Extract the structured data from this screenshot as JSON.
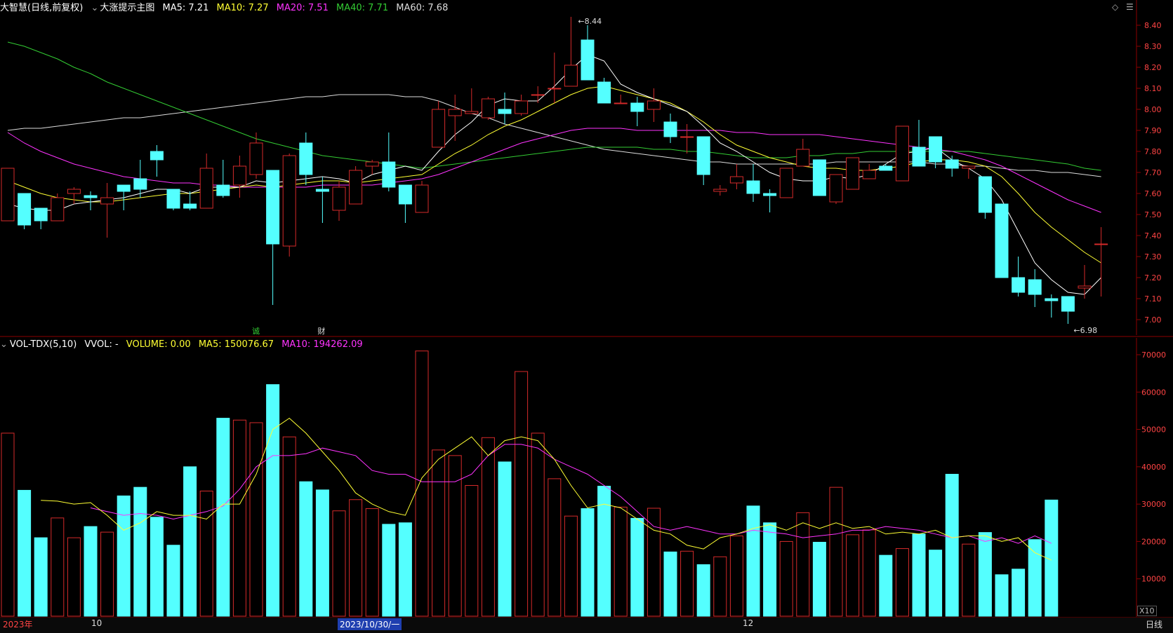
{
  "main_header": {
    "stock_name": "大智慧",
    "mode": "(日线,前复权)",
    "indicator": "大涨提示主图",
    "ma5": "MA5: 7.21",
    "ma10": "MA10: 7.27",
    "ma20": "MA20: 7.51",
    "ma40": "MA40: 7.71",
    "ma60": "MA60: 7.68"
  },
  "vol_header": {
    "indicator": "VOL-TDX(5,10)",
    "vvol": "VVOL: -",
    "volume": "VOLUME: 0.00",
    "ma5": "MA5: 150076.67",
    "ma10": "MA10: 194262.09"
  },
  "colors": {
    "up": "#d42a2a",
    "down": "#54ffff",
    "ma5": "#ffffff",
    "ma10": "#ffff33",
    "ma20": "#ff33ff",
    "ma40": "#33cc33",
    "ma60": "#dddddd",
    "axis": "#8b0000",
    "label_up": "#ff4444"
  },
  "chart_data": {
    "type": "candlestick",
    "price_axis": {
      "ticks": [
        "8.40",
        "8.30",
        "8.20",
        "8.10",
        "8.00",
        "7.90",
        "7.80",
        "7.70",
        "7.60",
        "7.50",
        "7.40",
        "7.30",
        "7.20",
        "7.10",
        "7.00"
      ],
      "range": [
        6.94,
        8.48
      ]
    },
    "annotations": {
      "high": "8.44",
      "low": "6.98"
    },
    "event_markers": [
      "诚",
      "财"
    ],
    "candles": [
      [
        7.47,
        7.72,
        7.47,
        7.72
      ],
      [
        7.6,
        7.6,
        7.43,
        7.45
      ],
      [
        7.53,
        7.53,
        7.43,
        7.47
      ],
      [
        7.47,
        7.6,
        7.47,
        7.58
      ],
      [
        7.6,
        7.63,
        7.55,
        7.62
      ],
      [
        7.59,
        7.61,
        7.52,
        7.58
      ],
      [
        7.55,
        7.65,
        7.39,
        7.58
      ],
      [
        7.64,
        7.64,
        7.52,
        7.61
      ],
      [
        7.67,
        7.76,
        7.58,
        7.62
      ],
      [
        7.8,
        7.83,
        7.68,
        7.76
      ],
      [
        7.62,
        7.62,
        7.52,
        7.53
      ],
      [
        7.55,
        7.61,
        7.52,
        7.53
      ],
      [
        7.53,
        7.79,
        7.53,
        7.72
      ],
      [
        7.64,
        7.76,
        7.58,
        7.59
      ],
      [
        7.64,
        7.78,
        7.58,
        7.73
      ],
      [
        7.69,
        7.89,
        7.67,
        7.84
      ],
      [
        7.71,
        7.71,
        7.07,
        7.36
      ],
      [
        7.35,
        7.79,
        7.3,
        7.78
      ],
      [
        7.84,
        7.89,
        7.64,
        7.69
      ],
      [
        7.62,
        7.68,
        7.46,
        7.61
      ],
      [
        7.52,
        7.66,
        7.47,
        7.63
      ],
      [
        7.55,
        7.73,
        7.55,
        7.71
      ],
      [
        7.73,
        7.76,
        7.69,
        7.75
      ],
      [
        7.75,
        7.89,
        7.61,
        7.63
      ],
      [
        7.64,
        7.64,
        7.46,
        7.55
      ],
      [
        7.51,
        7.66,
        7.51,
        7.64
      ],
      [
        7.82,
        8.04,
        7.82,
        8.0
      ],
      [
        7.97,
        8.07,
        7.85,
        8.0
      ],
      [
        7.98,
        8.1,
        7.98,
        7.99
      ],
      [
        7.96,
        8.06,
        7.95,
        8.05
      ],
      [
        8.0,
        8.08,
        7.93,
        7.98
      ],
      [
        7.98,
        8.07,
        7.97,
        8.04
      ],
      [
        8.07,
        8.11,
        8.03,
        8.07
      ],
      [
        8.1,
        8.27,
        8.03,
        8.1
      ],
      [
        8.11,
        8.44,
        8.11,
        8.21
      ],
      [
        8.33,
        8.4,
        8.14,
        8.14
      ],
      [
        8.13,
        8.15,
        8.04,
        8.03
      ],
      [
        8.03,
        8.07,
        8.04,
        8.03
      ],
      [
        8.03,
        8.06,
        7.92,
        7.99
      ],
      [
        8.0,
        8.1,
        7.94,
        8.04
      ],
      [
        7.94,
        7.98,
        7.84,
        7.87
      ],
      [
        7.87,
        7.93,
        7.79,
        7.87
      ],
      [
        7.87,
        7.87,
        7.64,
        7.69
      ],
      [
        7.61,
        7.64,
        7.59,
        7.62
      ],
      [
        7.65,
        7.74,
        7.62,
        7.68
      ],
      [
        7.66,
        7.74,
        7.56,
        7.6
      ],
      [
        7.6,
        7.62,
        7.51,
        7.59
      ],
      [
        7.58,
        7.72,
        7.58,
        7.72
      ],
      [
        7.73,
        7.86,
        7.73,
        7.81
      ],
      [
        7.76,
        7.76,
        7.65,
        7.59
      ],
      [
        7.56,
        7.67,
        7.55,
        7.69
      ],
      [
        7.62,
        7.72,
        7.62,
        7.77
      ],
      [
        7.67,
        7.74,
        7.67,
        7.71
      ],
      [
        7.73,
        7.74,
        7.73,
        7.71
      ],
      [
        7.66,
        7.92,
        7.66,
        7.92
      ],
      [
        7.82,
        7.95,
        7.73,
        7.73
      ],
      [
        7.87,
        7.87,
        7.72,
        7.75
      ],
      [
        7.76,
        7.78,
        7.68,
        7.72
      ],
      [
        7.72,
        7.72,
        7.67,
        7.73
      ],
      [
        7.68,
        7.68,
        7.48,
        7.51
      ],
      [
        7.55,
        7.55,
        7.2,
        7.2
      ],
      [
        7.2,
        7.3,
        7.11,
        7.13
      ],
      [
        7.19,
        7.24,
        7.06,
        7.12
      ],
      [
        7.1,
        7.12,
        7.01,
        7.09
      ],
      [
        7.11,
        7.11,
        6.98,
        7.04
      ],
      [
        7.15,
        7.26,
        7.1,
        7.16
      ],
      [
        7.36,
        7.44,
        7.11,
        7.36
      ]
    ],
    "ma5": [
      7.55,
      7.53,
      7.52,
      7.52,
      7.55,
      7.56,
      7.57,
      7.58,
      7.6,
      7.62,
      7.62,
      7.6,
      7.63,
      7.63,
      7.63,
      7.66,
      7.65,
      7.66,
      7.67,
      7.68,
      7.67,
      7.65,
      7.69,
      7.71,
      7.73,
      7.71,
      7.8,
      7.88,
      7.94,
      8.02,
      8.05,
      8.04,
      8.04,
      8.11,
      8.19,
      8.26,
      8.23,
      8.12,
      8.08,
      8.05,
      8.02,
      7.99,
      7.92,
      7.84,
      7.8,
      7.75,
      7.7,
      7.67,
      7.66,
      7.66,
      7.68,
      7.67,
      7.69,
      7.74,
      7.79,
      7.8,
      7.82,
      7.76,
      7.72,
      7.67,
      7.57,
      7.42,
      7.27,
      7.19,
      7.13,
      7.12,
      7.2
    ],
    "ma10": [
      7.66,
      7.63,
      7.6,
      7.58,
      7.57,
      7.56,
      7.56,
      7.57,
      7.58,
      7.59,
      7.6,
      7.6,
      7.61,
      7.62,
      7.63,
      7.64,
      7.63,
      7.64,
      7.65,
      7.66,
      7.66,
      7.65,
      7.66,
      7.67,
      7.68,
      7.69,
      7.74,
      7.79,
      7.83,
      7.88,
      7.92,
      7.95,
      7.99,
      8.03,
      8.07,
      8.1,
      8.11,
      8.09,
      8.07,
      8.05,
      8.03,
      7.99,
      7.94,
      7.88,
      7.83,
      7.8,
      7.77,
      7.75,
      7.73,
      7.72,
      7.72,
      7.71,
      7.71,
      7.72,
      7.73,
      7.75,
      7.76,
      7.76,
      7.75,
      7.73,
      7.68,
      7.6,
      7.51,
      7.44,
      7.38,
      7.32,
      7.27
    ],
    "ma20": [
      7.89,
      7.84,
      7.8,
      7.77,
      7.74,
      7.72,
      7.7,
      7.68,
      7.67,
      7.66,
      7.65,
      7.65,
      7.64,
      7.64,
      7.63,
      7.63,
      7.63,
      7.63,
      7.63,
      7.64,
      7.64,
      7.64,
      7.64,
      7.65,
      7.66,
      7.67,
      7.69,
      7.72,
      7.75,
      7.78,
      7.81,
      7.84,
      7.86,
      7.88,
      7.9,
      7.91,
      7.91,
      7.91,
      7.9,
      7.9,
      7.9,
      7.9,
      7.9,
      7.9,
      7.89,
      7.89,
      7.88,
      7.88,
      7.88,
      7.88,
      7.87,
      7.86,
      7.85,
      7.84,
      7.83,
      7.82,
      7.81,
      7.8,
      7.78,
      7.76,
      7.73,
      7.69,
      7.65,
      7.61,
      7.57,
      7.54,
      7.51
    ],
    "ma40": [
      8.32,
      8.3,
      8.27,
      8.24,
      8.2,
      8.17,
      8.13,
      8.1,
      8.07,
      8.04,
      8.01,
      7.98,
      7.95,
      7.92,
      7.89,
      7.86,
      7.84,
      7.82,
      7.8,
      7.78,
      7.77,
      7.76,
      7.75,
      7.74,
      7.73,
      7.72,
      7.73,
      7.74,
      7.75,
      7.76,
      7.77,
      7.78,
      7.79,
      7.8,
      7.81,
      7.82,
      7.82,
      7.82,
      7.82,
      7.81,
      7.81,
      7.8,
      7.8,
      7.79,
      7.78,
      7.77,
      7.77,
      7.77,
      7.78,
      7.78,
      7.79,
      7.79,
      7.8,
      7.8,
      7.8,
      7.8,
      7.8,
      7.8,
      7.8,
      7.79,
      7.78,
      7.77,
      7.76,
      7.75,
      7.74,
      7.72,
      7.71
    ],
    "ma60": [
      7.9,
      7.91,
      7.91,
      7.92,
      7.93,
      7.94,
      7.95,
      7.96,
      7.96,
      7.97,
      7.98,
      7.99,
      8.0,
      8.01,
      8.02,
      8.03,
      8.04,
      8.05,
      8.06,
      8.06,
      8.07,
      8.07,
      8.07,
      8.07,
      8.06,
      8.06,
      8.04,
      8.01,
      7.98,
      7.96,
      7.93,
      7.91,
      7.89,
      7.87,
      7.85,
      7.83,
      7.81,
      7.8,
      7.79,
      7.78,
      7.77,
      7.76,
      7.75,
      7.75,
      7.74,
      7.74,
      7.74,
      7.74,
      7.74,
      7.74,
      7.75,
      7.75,
      7.75,
      7.75,
      7.75,
      7.75,
      7.74,
      7.74,
      7.73,
      7.73,
      7.72,
      7.71,
      7.71,
      7.7,
      7.7,
      7.69,
      7.68
    ],
    "volume_axis": {
      "ticks": [
        "70000",
        "60000",
        "50000",
        "40000",
        "30000",
        "20000",
        "10000"
      ],
      "unit": "X10",
      "max": 74000
    },
    "volume": [
      49000,
      33700,
      21000,
      26300,
      21000,
      24000,
      22500,
      32200,
      34500,
      26500,
      19000,
      40000,
      33500,
      53000,
      52500,
      51800,
      62000,
      48000,
      36000,
      33800,
      28200,
      31200,
      28800,
      24600,
      25000,
      71000,
      44500,
      43000,
      35000,
      47800,
      41300,
      65500,
      49000,
      36800,
      26800,
      28800,
      34800,
      29200,
      26200,
      28900,
      17200,
      17400,
      13800,
      15900,
      21500,
      29500,
      25000,
      20000,
      27700,
      19800,
      34500,
      21800,
      23100,
      16300,
      18100,
      22000,
      17700,
      38000,
      19300,
      22400,
      11100,
      12600,
      20500,
      31100
    ],
    "vol_ma5": [
      31000,
      30800,
      30000,
      30400,
      27000,
      23000,
      25000,
      28000,
      27000,
      27000,
      26000,
      30000,
      30000,
      38000,
      50000,
      53000,
      49000,
      44000,
      39000,
      33000,
      30000,
      28000,
      27000,
      37000,
      42000,
      45000,
      48000,
      43000,
      47000,
      48000,
      47000,
      42000,
      35000,
      29000,
      30000,
      29000,
      26000,
      23000,
      22000,
      19000,
      18000,
      21000,
      22000,
      23500,
      24500,
      23000,
      25000,
      23500,
      25000,
      23500,
      24000,
      22000,
      22500,
      22000,
      23000,
      21000,
      21500,
      21500,
      20000,
      21000,
      17000,
      15000
    ],
    "vol_ma10": [
      29000,
      28000,
      27000,
      27500,
      27000,
      26000,
      27000,
      28000,
      29500,
      34000,
      40000,
      43000,
      43000,
      43500,
      45000,
      44000,
      43000,
      39000,
      38000,
      38000,
      36000,
      36000,
      36000,
      38000,
      43000,
      46000,
      46000,
      45000,
      42000,
      40000,
      38000,
      35000,
      32000,
      28000,
      24000,
      23000,
      24000,
      23000,
      22000,
      22000,
      23000,
      22500,
      22000,
      21000,
      21500,
      22000,
      23000,
      23000,
      24000,
      23500,
      23000,
      22000,
      21000,
      21500,
      20000,
      21000,
      19500,
      21500,
      19500
    ],
    "x_labels": [
      "2023年",
      "10",
      "2023/10/30/一",
      "12"
    ],
    "period_label": "日线"
  }
}
